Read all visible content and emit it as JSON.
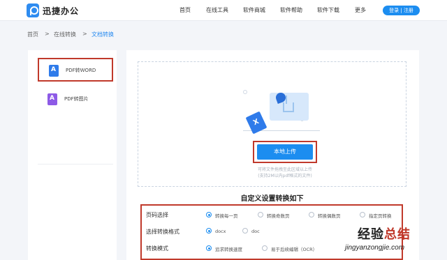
{
  "header": {
    "brand": "迅捷办公",
    "nav": [
      "首页",
      "在线工具",
      "软件商城",
      "软件帮助",
      "软件下载",
      "更多"
    ],
    "login_label": "登录 | 注册"
  },
  "breadcrumb": {
    "items": [
      "首页",
      ">",
      "在线转换",
      ">",
      "文档转换"
    ]
  },
  "sidebar": {
    "items": [
      {
        "label": "PDF转WORD"
      },
      {
        "label": "PDF转图片"
      }
    ]
  },
  "upload": {
    "button_label": "本地上传",
    "hint_line1": "可将文件拖拽至此区域以上传",
    "hint_line2": "(支持2M以内pdf格式的文件)"
  },
  "settings": {
    "title": "自定义设置转换如下",
    "rows": [
      {
        "label": "页码选择",
        "options": [
          "转换每一页",
          "转换奇数页",
          "转换偶数页",
          "指定页转换"
        ],
        "selected": 0
      },
      {
        "label": "选择转换格式",
        "options": [
          "docx",
          "doc"
        ],
        "selected": 0
      },
      {
        "label": "转换模式",
        "options": [
          "追求转换速度",
          "易于后续编辑（OCR）"
        ],
        "selected": 0
      }
    ]
  },
  "watermark": {
    "title_black": "经验",
    "title_red": "总结",
    "url": "jingyanzongjie.com"
  },
  "colors": {
    "accent": "#1c8df0",
    "highlight_border": "#c0392b",
    "background": "#f3f5f9"
  }
}
